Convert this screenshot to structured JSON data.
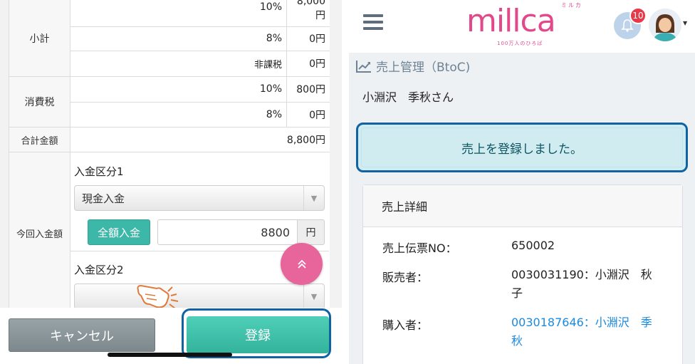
{
  "left_screen": {
    "table": {
      "subtotal_label": "小計",
      "subtotal_rows": [
        {
          "rate": "10%",
          "amount": "8,000\n円"
        },
        {
          "rate": "8%",
          "amount": "0円"
        },
        {
          "rate": "非課税",
          "amount": "0円"
        }
      ],
      "tax_label": "消費税",
      "tax_rows": [
        {
          "rate": "10%",
          "amount": "800円"
        },
        {
          "rate": "8%",
          "amount": "0円"
        }
      ],
      "total_label": "合計金額",
      "total_value": "8,800円",
      "payment_label": "今回入金額",
      "payment_type1_label": "入金区分1",
      "payment_type1_value": "現金入金",
      "full_payment_button": "全額入金",
      "amount_value": "8800",
      "yen_unit": "円",
      "payment_type2_label": "入金区分2",
      "payment_type2_value": ""
    },
    "cancel_button": "キャンセル",
    "register_button": "登録",
    "scroll_top_icon": "double-chevron-up-icon"
  },
  "right_screen": {
    "logo": "millca",
    "logo_kana": "ミルカ",
    "logo_tagline": "100万人のひろば",
    "notification_count": "10",
    "page_title": "売上管理（BtoC)",
    "customer_name": "小淵沢　季秋さん",
    "alert_message": "売上を登録しました。",
    "detail": {
      "heading": "売上詳細",
      "rows": [
        {
          "label": "売上伝票NO：",
          "value": "650002"
        },
        {
          "label": "販売者：",
          "value": "0030031190：小淵沢　秋子"
        },
        {
          "label": "購入者：",
          "value": "0030187646：小淵沢　季秋"
        }
      ]
    },
    "colors": {
      "brand": "#e3488a",
      "link": "#1a8ae0",
      "highlight": "#0f63a3",
      "alert_bg": "#d1ecf1"
    }
  }
}
